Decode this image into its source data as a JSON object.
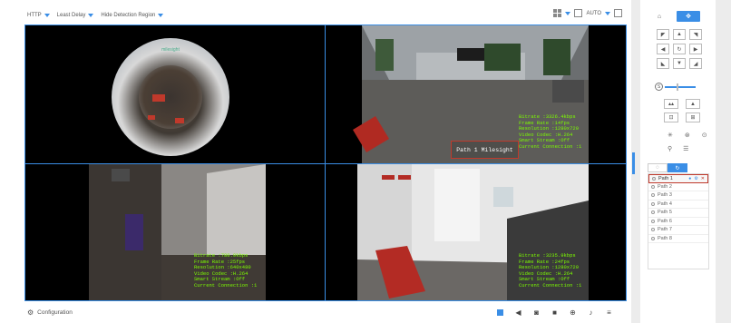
{
  "toolbar": {
    "protocol": "HTTP",
    "delay": "Least Delay",
    "detection": "Hide Detection Region",
    "auto_label": "AUTO"
  },
  "cells": {
    "cell2_osd": "Bitrate :3326.4kbps\nFrame Rate :14fps\nResolution :1280x720\nVideo Codec :H.264\nSmart Stream :Off\nCurrent Connection :1",
    "cell3_osd": "Bitrate :780.9kbps\nFrame Rate :25fps\nResolution :640x480\nVideo Codec :H.264\nSmart Stream :Off\nCurrent Connection :1",
    "cell4_osd": "Bitrate :3235.9kbps\nFrame Rate :24fps\nResolution :1280x720\nVideo Codec :H.264\nSmart Stream :Off\nCurrent Connection :1",
    "path_overlay": "Path 1  Milesight",
    "fisheye_logo": "milesight"
  },
  "bottom": {
    "configuration": "Configuration"
  },
  "panel": {
    "path_items": [
      "Path 1",
      "Path 2",
      "Path 3",
      "Path 4",
      "Path 5",
      "Path 6",
      "Path 7",
      "Path 8"
    ]
  },
  "colors": {
    "accent": "#3a8ee6",
    "highlight": "#c0392b",
    "osd": "#7cfc00"
  }
}
